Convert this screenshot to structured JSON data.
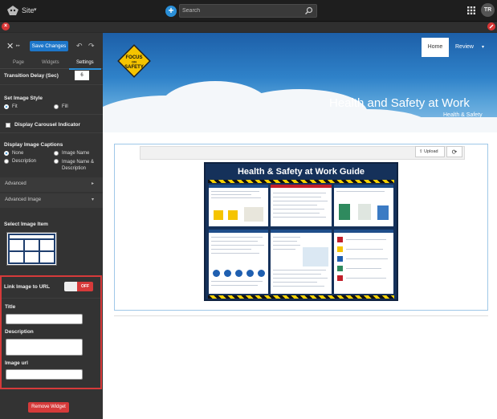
{
  "topbar": {
    "site_label": "Site",
    "search_placeholder": "Search",
    "avatar_initials": "TR",
    "accent": "#2a8fd8"
  },
  "sidebar": {
    "save_label": "Save Changes",
    "tabs": [
      {
        "label": "Page"
      },
      {
        "label": "Widgets"
      },
      {
        "label": "Settings"
      }
    ],
    "transition_delay_label": "Transition Delay (Sec)",
    "transition_delay_value": "6",
    "image_style_label": "Set Image Style",
    "image_style_options": [
      {
        "label": "Fit",
        "selected": true
      },
      {
        "label": "Fill",
        "selected": false
      }
    ],
    "carousel_indicator_label": "Display Carousel Indicator",
    "captions_label": "Display Image Captions",
    "caption_options": [
      {
        "label": "None",
        "selected": true
      },
      {
        "label": "Image Name",
        "selected": false
      },
      {
        "label": "Description",
        "selected": false
      },
      {
        "label": "Image Name & Description",
        "selected": false
      }
    ],
    "advanced_label": "Advanced",
    "advanced_image_label": "Advanced Image",
    "select_image_label": "Select Image Item",
    "link_image_label": "Link Image to URL",
    "toggle_state": "OFF",
    "title_label": "Title",
    "description_label": "Description",
    "image_url_label": "Image url",
    "remove_widget_label": "Remove Widget",
    "highlight_color": "#d63a3a"
  },
  "page": {
    "nav": [
      {
        "label": "Home",
        "active": true
      },
      {
        "label": "Review",
        "active": false
      }
    ],
    "sign_text_top": "FOCUS",
    "sign_text_mid": "ON",
    "sign_text_bottom": "SAFETY",
    "hero_title": "Health and Safety at Work",
    "hero_subtitle": "Health & Safety",
    "upload_label": "Upload",
    "poster_title": "Health & Safety at Work Guide"
  }
}
